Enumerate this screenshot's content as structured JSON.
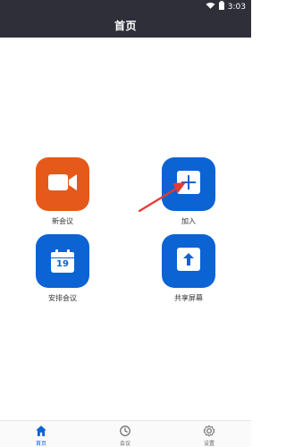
{
  "status_bar": {
    "time": "3:03",
    "wifi_icon": "wifi-icon",
    "battery_icon": "battery-icon"
  },
  "header": {
    "title": "首页"
  },
  "tiles": [
    {
      "label": "新会议",
      "icon": "video-camera-icon",
      "color": "#e55a1a"
    },
    {
      "label": "加入",
      "icon": "plus-square-icon",
      "color": "#0b63d4"
    },
    {
      "label": "安排会议",
      "icon": "calendar-icon",
      "color": "#0b63d4",
      "calendar_day": "19"
    },
    {
      "label": "共享屏幕",
      "icon": "upload-icon",
      "color": "#0b63d4"
    }
  ],
  "bottom_nav": [
    {
      "label": "首页",
      "icon": "home-icon",
      "active": true
    },
    {
      "label": "会议",
      "icon": "clock-icon",
      "active": false
    },
    {
      "label": "设置",
      "icon": "gear-icon",
      "active": false
    }
  ],
  "annotation": {
    "arrow_color": "#e53935",
    "arrow_icon": "arrow-pointer"
  }
}
